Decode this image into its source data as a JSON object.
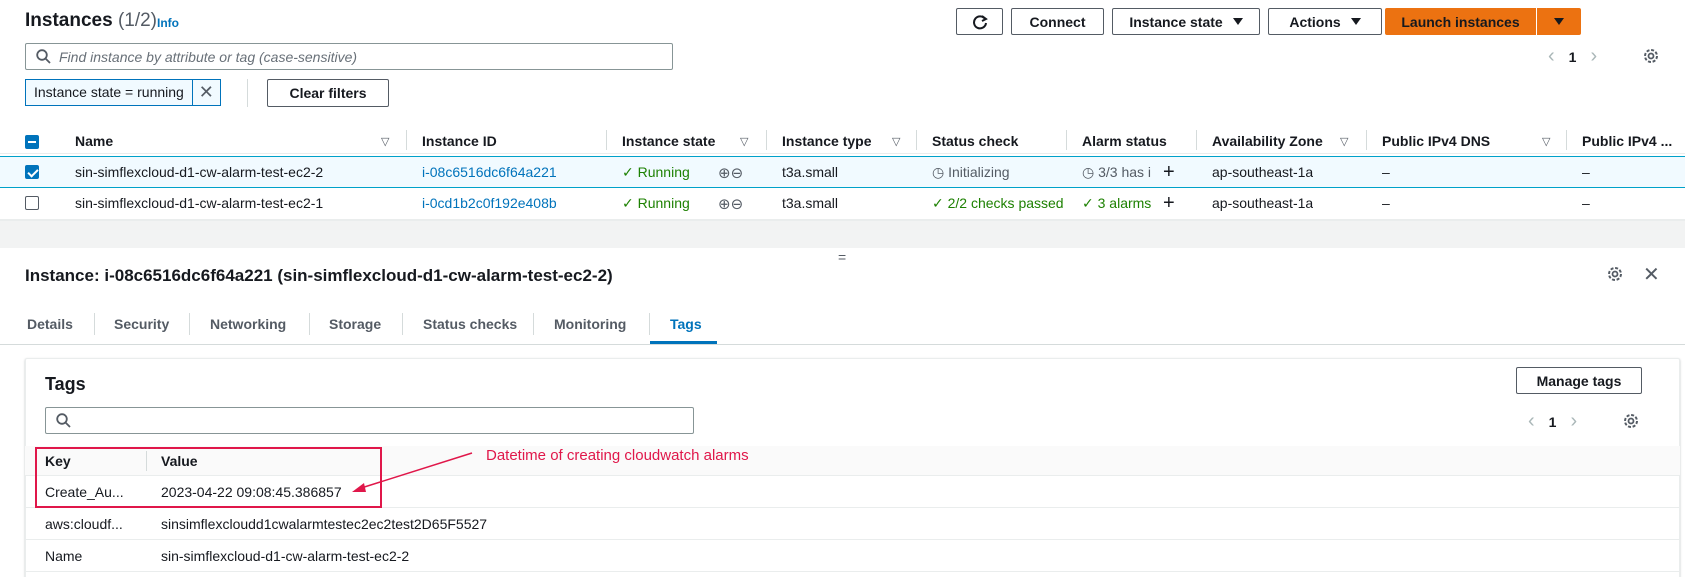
{
  "header": {
    "title": "Instances",
    "count": "(1/2)",
    "info": "Info",
    "connect": "Connect",
    "instance_state": "Instance state",
    "actions": "Actions",
    "launch": "Launch instances"
  },
  "search": {
    "placeholder": "Find instance by attribute or tag (case-sensitive)"
  },
  "pagination": {
    "page": "1"
  },
  "filter": {
    "chip": "Instance state = running",
    "clear": "Clear filters"
  },
  "table": {
    "columns": [
      "Name",
      "Instance ID",
      "Instance state",
      "Instance type",
      "Status check",
      "Alarm status",
      "Availability Zone",
      "Public IPv4 DNS",
      "Public IPv4 ..."
    ],
    "rows": [
      {
        "name": "sin-simflexcloud-d1-cw-alarm-test-ec2-2",
        "id": "i-08c6516dc6f64a221",
        "state": "Running",
        "type": "t3a.small",
        "status_check": "Initializing",
        "alarm": "3/3 has i",
        "az": "ap-southeast-1a",
        "dns": "–",
        "ipv4": "–",
        "selected": true
      },
      {
        "name": "sin-simflexcloud-d1-cw-alarm-test-ec2-1",
        "id": "i-0cd1b2c0f192e408b",
        "state": "Running",
        "type": "t3a.small",
        "status_check": "2/2 checks passed",
        "alarm": "3 alarms",
        "az": "ap-southeast-1a",
        "dns": "–",
        "ipv4": "–",
        "selected": false
      }
    ]
  },
  "details": {
    "title": "Instance: i-08c6516dc6f64a221 (sin-simflexcloud-d1-cw-alarm-test-ec2-2)",
    "tabs": [
      "Details",
      "Security",
      "Networking",
      "Storage",
      "Status checks",
      "Monitoring",
      "Tags"
    ],
    "active_tab": "Tags"
  },
  "tags": {
    "title": "Tags",
    "manage": "Manage tags",
    "page": "1",
    "columns": [
      "Key",
      "Value"
    ],
    "rows": [
      {
        "key": "Create_Au...",
        "value": "2023-04-22 09:08:45.386857"
      },
      {
        "key": "aws:cloudf...",
        "value": "sinsimflexcloudd1cwalarmtestec2ec2test2D65F5527"
      },
      {
        "key": "Name",
        "value": "sin-simflexcloud-d1-cw-alarm-test-ec2-2"
      }
    ]
  },
  "annotation": {
    "text": "Datetime of creating cloudwatch alarms"
  },
  "colors": {
    "primary": "#ec7211",
    "link": "#0073bb",
    "success": "#1d8102",
    "annotation": "#e0174a"
  }
}
